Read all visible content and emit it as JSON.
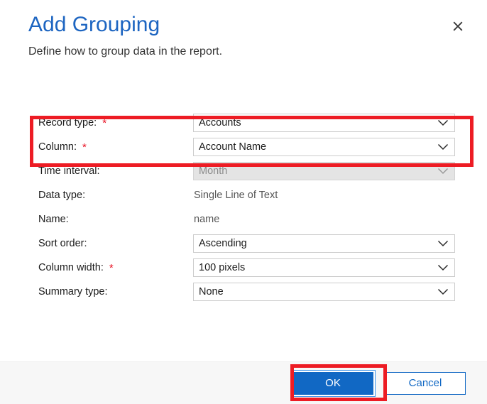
{
  "dialog": {
    "title": "Add Grouping",
    "subtitle": "Define how to group data in the report.",
    "close_icon": "close-icon"
  },
  "form": {
    "rows": [
      {
        "label": "Record type:",
        "required": true,
        "star": "*",
        "type": "select",
        "value": "Accounts",
        "disabled": false,
        "name": "record-type"
      },
      {
        "label": "Column:",
        "required": true,
        "star": "*",
        "type": "select",
        "value": "Account Name",
        "disabled": false,
        "name": "column"
      },
      {
        "label": "Time interval:",
        "required": false,
        "star": "",
        "type": "select",
        "value": "Month",
        "disabled": true,
        "name": "time-interval"
      },
      {
        "label": "Data type:",
        "required": false,
        "star": "",
        "type": "text",
        "value": "Single Line of Text",
        "disabled": false,
        "name": "data-type"
      },
      {
        "label": "Name:",
        "required": false,
        "star": "",
        "type": "text",
        "value": "name",
        "disabled": false,
        "name": "name"
      },
      {
        "label": "Sort order:",
        "required": false,
        "star": "",
        "type": "select",
        "value": "Ascending",
        "disabled": false,
        "name": "sort-order"
      },
      {
        "label": "Column width:",
        "required": true,
        "star": "*",
        "type": "select",
        "value": "100 pixels",
        "disabled": false,
        "name": "column-width"
      },
      {
        "label": "Summary type:",
        "required": false,
        "star": "",
        "type": "select",
        "value": "None",
        "disabled": false,
        "name": "summary-type"
      }
    ]
  },
  "footer": {
    "ok_label": "OK",
    "cancel_label": "Cancel"
  },
  "annotations": [
    {
      "name": "highlight-record-type-and-column",
      "color": "#ed1c24"
    },
    {
      "name": "highlight-ok-button",
      "color": "#ed1c24"
    }
  ],
  "colors": {
    "title_blue": "#1d65c1",
    "accent_blue": "#1168c4",
    "required_red": "#e81123",
    "annotation_red": "#ed1c24",
    "footer_bg": "#f7f7f7",
    "disabled_bg": "#e4e4e4"
  }
}
